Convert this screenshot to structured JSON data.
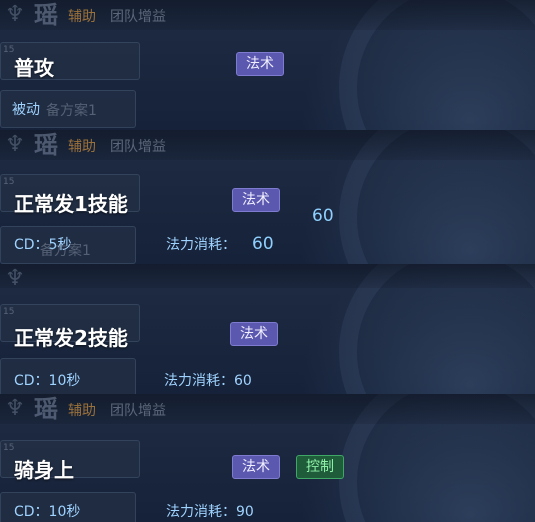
{
  "hero": {
    "name": "瑶",
    "role": "辅助",
    "tag": "团队增益",
    "preset": "备方案1",
    "preset_partial": "备方案1"
  },
  "tags": {
    "magic": "法术",
    "control": "控制"
  },
  "skills": [
    {
      "name": "普攻",
      "passive": "被动"
    },
    {
      "name": "正常发1技能",
      "cd": "CD：5秒",
      "mana": "法力消耗：",
      "mana_value": "60",
      "overlap_value": "60"
    },
    {
      "name": "正常发2技能",
      "cd": "CD：10秒",
      "mana": "法力消耗：60"
    },
    {
      "name": "骑身上",
      "cd": "CD：10秒",
      "mana": "法力消耗：90"
    }
  ],
  "colors": {
    "magic_tag": "#5b58b0",
    "control_tag": "#1f5d3a",
    "info_text": "#9fd3ff",
    "role_text": "#c88c3c"
  }
}
